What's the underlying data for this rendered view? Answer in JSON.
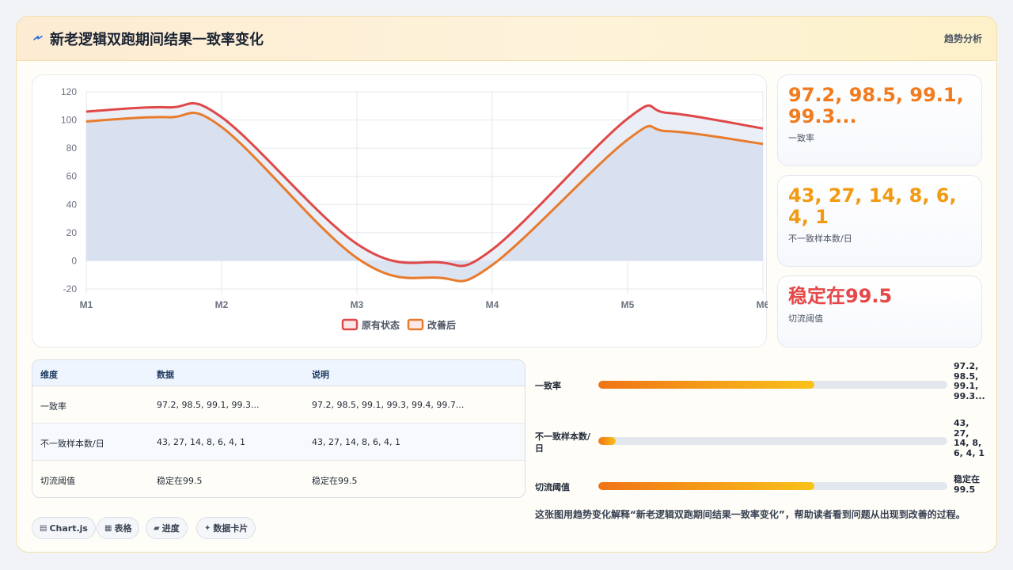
{
  "header": {
    "title": "新老逻辑双跑期间结果一致率变化",
    "tag": "趋势分析",
    "icon": "bolt-icon"
  },
  "chart_data": {
    "type": "area",
    "categories": [
      "M1",
      "M2",
      "M3",
      "M4",
      "M5",
      "M6"
    ],
    "y_ticks": [
      "120",
      "100",
      "80",
      "60",
      "40",
      "20",
      "0",
      "-20"
    ],
    "ylim": [
      -20,
      120
    ],
    "grid": true,
    "legend_position": "bottom",
    "series": [
      {
        "name": "原有状态",
        "values": [
          106,
          109,
          102,
          12,
          -1,
          8,
          101,
          105,
          94
        ],
        "x": [
          1,
          1.6,
          2,
          3,
          3.6,
          4,
          5,
          5.3,
          6
        ],
        "color": "#e04848"
      },
      {
        "name": "改善后",
        "values": [
          99,
          102,
          95,
          2,
          -12,
          -3,
          86,
          92,
          83
        ],
        "x": [
          1,
          1.6,
          2,
          3,
          3.6,
          4,
          5,
          5.3,
          6
        ],
        "color": "#e87b2c"
      }
    ],
    "smooth": true
  },
  "stats": [
    {
      "value": "97.2, 98.5, 99.1, 99.3...",
      "label": "一致率",
      "color": "#f27b1e"
    },
    {
      "value": "43, 27, 14, 8, 6, 4, 1",
      "label": "不一致样本数/日",
      "color": "#f29a12"
    },
    {
      "value": "稳定在99.5",
      "label": "切流阈值",
      "color": "#e54848"
    }
  ],
  "table": {
    "headers": [
      "维度",
      "数据",
      "说明"
    ],
    "rows": [
      [
        "一致率",
        "97.2, 98.5, 99.1, 99.3...",
        "97.2, 98.5, 99.1, 99.3, 99.4, 99.7..."
      ],
      [
        "不一致样本数/日",
        "43, 27, 14, 8, 6, 4, 1",
        "43, 27, 14, 8, 6, 4, 1"
      ],
      [
        "切流阈值",
        "稳定在99.5",
        "稳定在99.5"
      ]
    ]
  },
  "progress": [
    {
      "label": "一致率",
      "value": "97.2, 98.5, 99.1, 99.3...",
      "fill": 0.62
    },
    {
      "label": "不一致样本数/日",
      "value": "43, 27, 14, 8, 6, 4, 1",
      "fill": 0.05
    },
    {
      "label": "切流阈值",
      "value": "稳定在99.5",
      "fill": 0.62
    }
  ],
  "chips": [
    {
      "icon": "▤",
      "label": "Chart.js"
    },
    {
      "icon": "▦",
      "label": "表格"
    },
    {
      "icon": "▰",
      "label": "进度"
    },
    {
      "icon": "✦",
      "label": "数据卡片"
    }
  ],
  "note": "这张图用趋势变化解释“新老逻辑双跑期间结果一致率变化”，帮助读者看到问题从出现到改善的过程。"
}
